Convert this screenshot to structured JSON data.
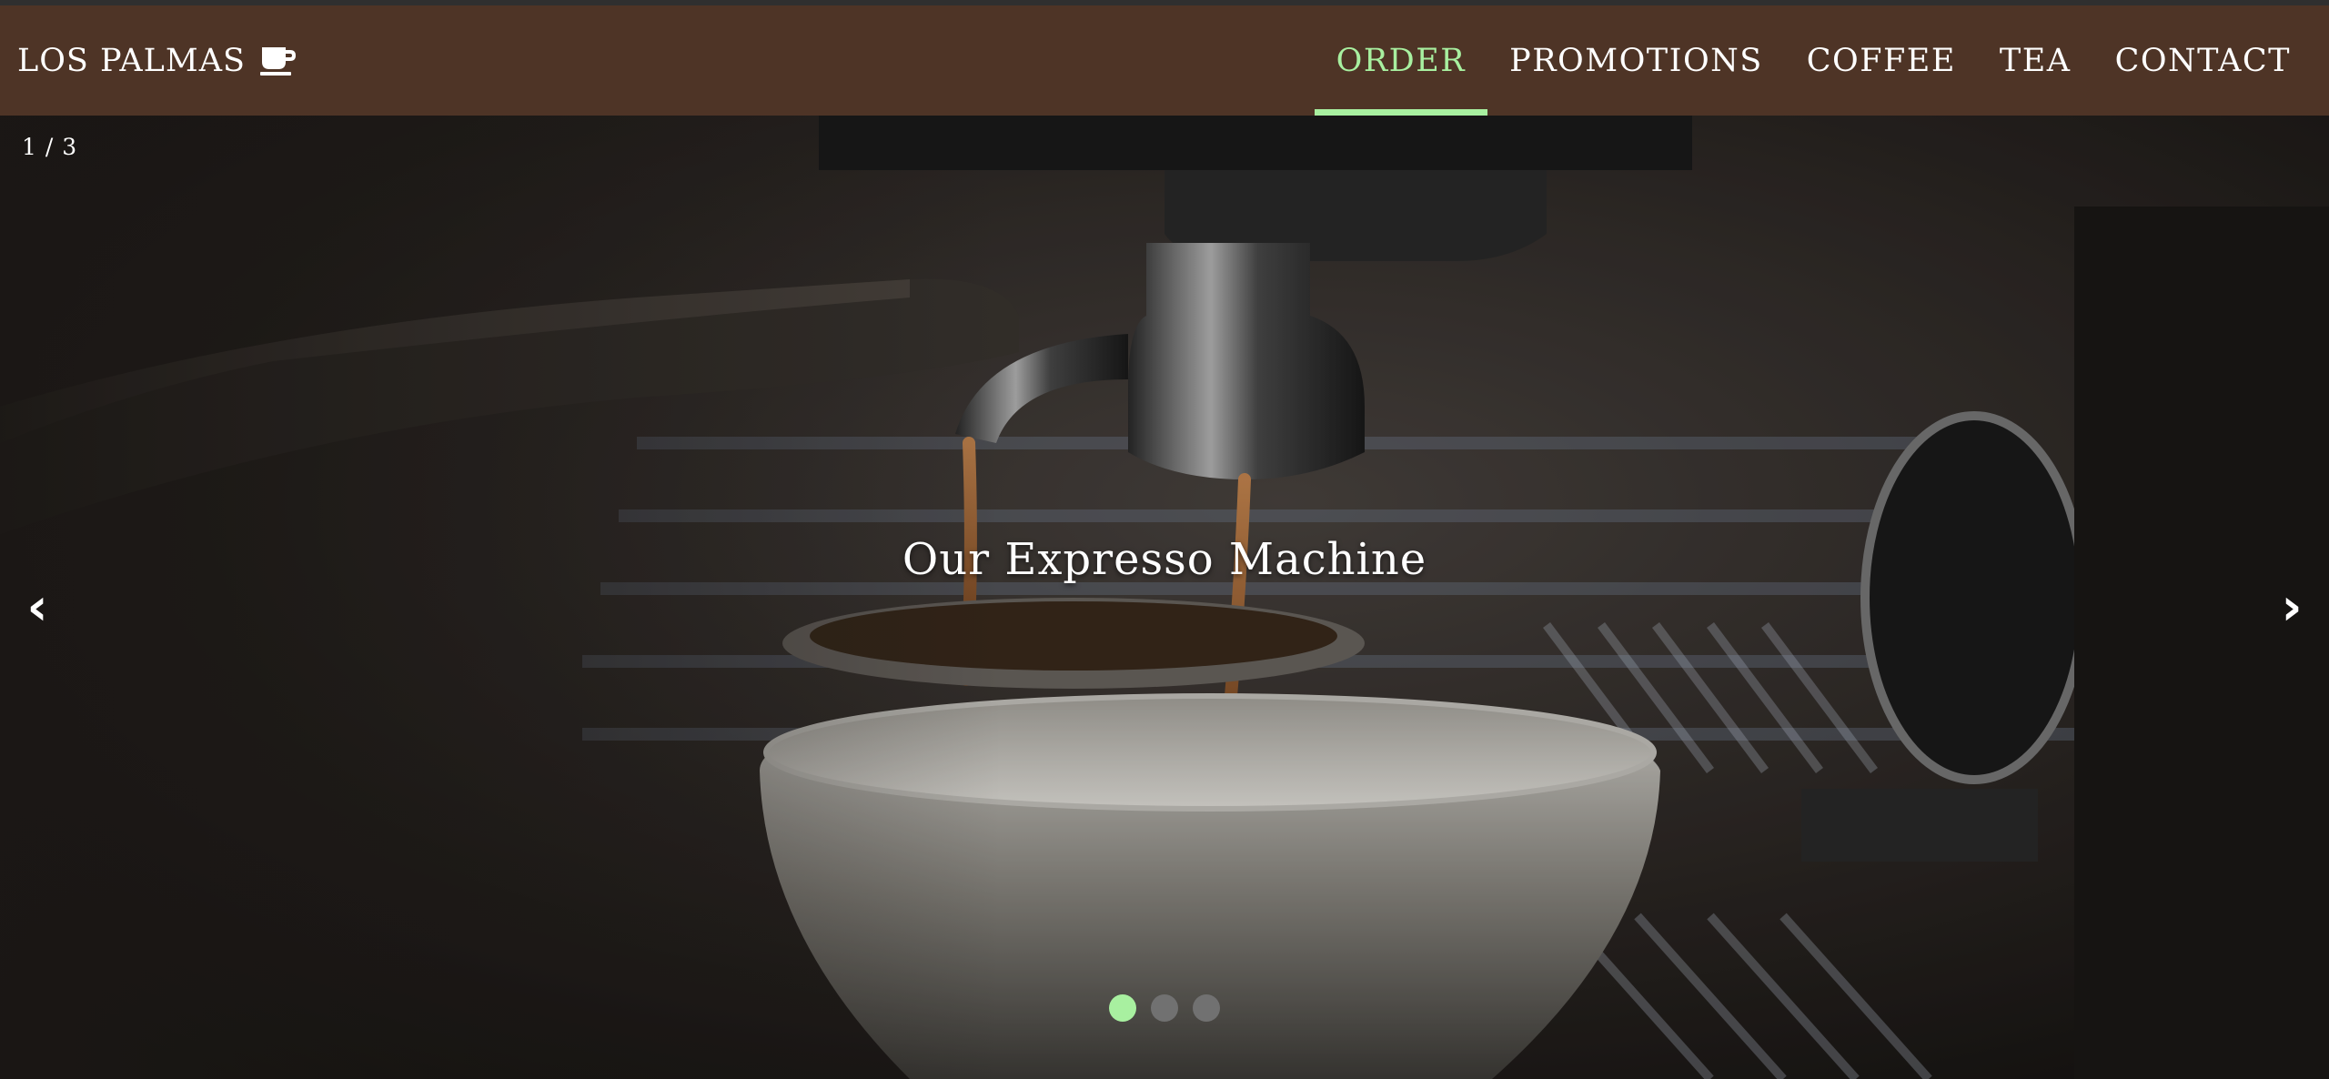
{
  "brand": {
    "name": "LOS PALMAS",
    "icon": "coffee-cup-icon"
  },
  "nav": {
    "items": [
      {
        "label": "ORDER",
        "active": true
      },
      {
        "label": "PROMOTIONS",
        "active": false
      },
      {
        "label": "COFFEE",
        "active": false
      },
      {
        "label": "TEA",
        "active": false
      },
      {
        "label": "CONTACT",
        "active": false
      }
    ]
  },
  "slider": {
    "counter": "1 / 3",
    "caption": "Our Expresso Machine",
    "prev_label": "‹",
    "next_label": "›",
    "dots": [
      {
        "active": true
      },
      {
        "active": false
      },
      {
        "active": false
      }
    ]
  },
  "colors": {
    "navbar_bg": "#4e3426",
    "accent": "#a8f0a0",
    "dot_inactive": "#717171"
  }
}
